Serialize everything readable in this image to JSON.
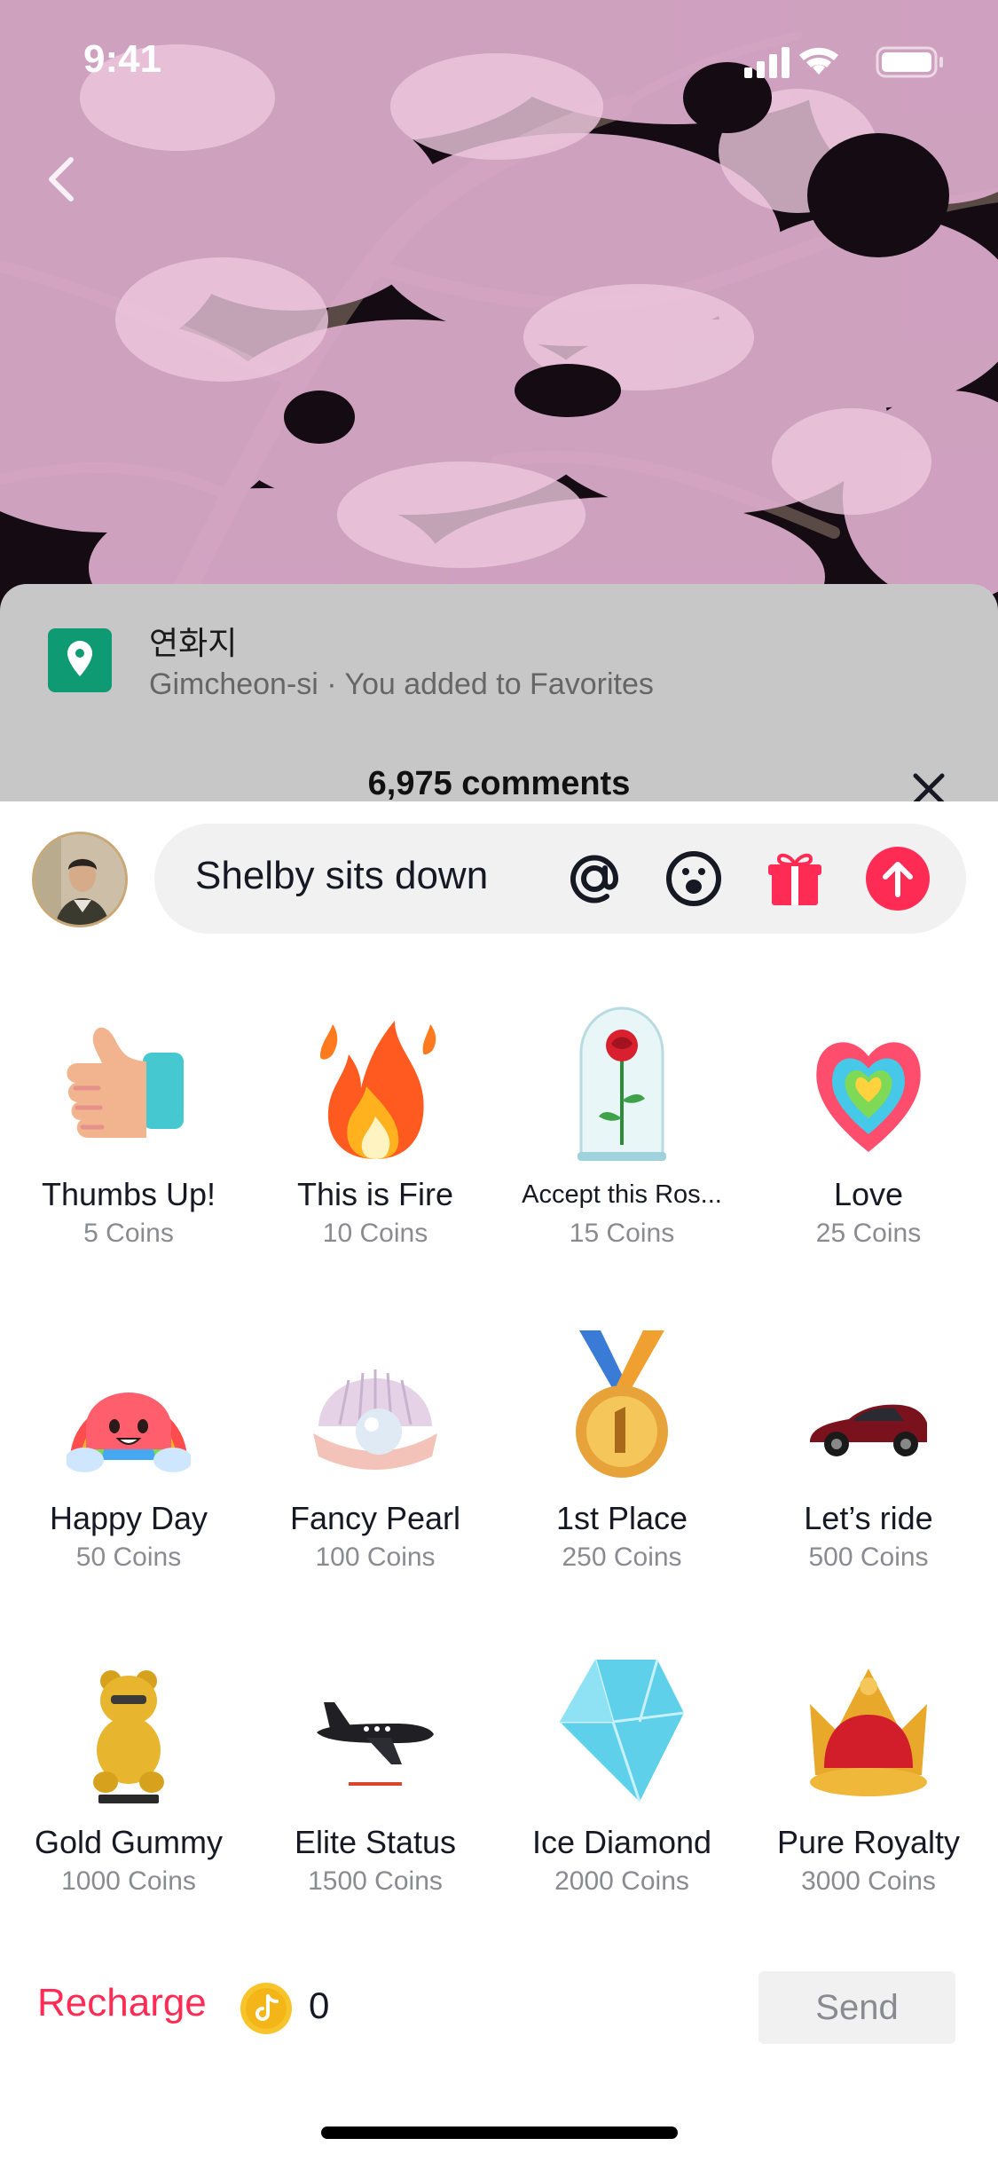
{
  "status_bar": {
    "time": "9:41"
  },
  "location": {
    "name": "연화지",
    "subtitle": "Gimcheon-si · You added to Favorites"
  },
  "comments": {
    "count_label": "6,975 comments"
  },
  "composer": {
    "text": "Shelby sits down"
  },
  "gifts": [
    {
      "name": "Thumbs Up!",
      "price": "5 Coins"
    },
    {
      "name": "This is Fire",
      "price": "10 Coins"
    },
    {
      "name": "Accept this Ros...",
      "price": "15 Coins"
    },
    {
      "name": "Love",
      "price": "25 Coins"
    },
    {
      "name": "Happy Day",
      "price": "50 Coins"
    },
    {
      "name": "Fancy Pearl",
      "price": "100 Coins"
    },
    {
      "name": "1st Place",
      "price": "250 Coins"
    },
    {
      "name": "Let’s ride",
      "price": "500 Coins"
    },
    {
      "name": "Gold Gummy",
      "price": "1000 Coins"
    },
    {
      "name": "Elite Status",
      "price": "1500 Coins"
    },
    {
      "name": "Ice Diamond",
      "price": "2000 Coins"
    },
    {
      "name": "Pure Royalty",
      "price": "3000 Coins"
    }
  ],
  "footer": {
    "recharge_label": "Recharge",
    "balance": "0",
    "send_label": "Send"
  },
  "colors": {
    "accent": "#fe2c55",
    "pin_green": "#0e9a72",
    "coin_yellow": "#f7c52b"
  }
}
